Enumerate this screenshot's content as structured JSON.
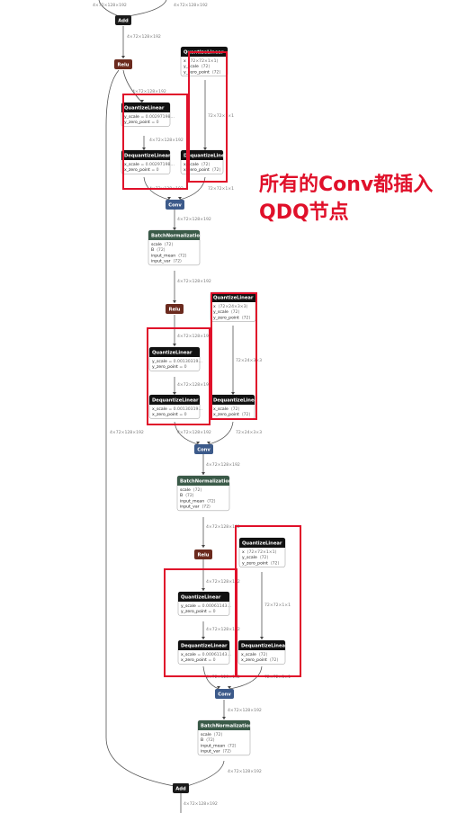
{
  "annotation": {
    "line1": "所有的Conv都插入",
    "line2": "QDQ节点"
  },
  "colors": {
    "add": "#1a1a1a",
    "relu": "#6b2a1e",
    "conv": "#3c5a8a",
    "bn": "#3a5a48",
    "quant": "#111111",
    "highlight": "#e0102a",
    "edge": "#555555"
  },
  "nodes": {
    "add_top": {
      "label": "Add"
    },
    "relu1": {
      "label": "Relu"
    },
    "quant_w1": {
      "title": "QuantizeLinear",
      "rows": [
        [
          "x",
          "⟨72×72×1×1⟩"
        ],
        [
          "y_scale",
          "⟨72⟩"
        ],
        [
          "y_zero_point",
          "⟨72⟩"
        ]
      ]
    },
    "quant_a1": {
      "title": "QuantizeLinear",
      "rows": [
        [
          "y_scale",
          "= 0.00297198…"
        ],
        [
          "y_zero_point",
          "= 0"
        ]
      ]
    },
    "dequant_a1": {
      "title": "DequantizeLinear",
      "rows": [
        [
          "x_scale",
          "= 0.00297198…"
        ],
        [
          "x_zero_point",
          "= 0"
        ]
      ]
    },
    "dequant_w1": {
      "title": "DequantizeLinear",
      "rows": [
        [
          "x_scale",
          "⟨72⟩"
        ],
        [
          "x_zero_point",
          "⟨72⟩"
        ]
      ]
    },
    "conv1": {
      "label": "Conv"
    },
    "bn1": {
      "title": "BatchNormalization",
      "rows": [
        [
          "scale",
          "⟨72⟩"
        ],
        [
          "B",
          "⟨72⟩"
        ],
        [
          "input_mean",
          "⟨72⟩"
        ],
        [
          "input_var",
          "⟨72⟩"
        ]
      ]
    },
    "relu2": {
      "label": "Relu"
    },
    "quant_w2": {
      "title": "QuantizeLinear",
      "rows": [
        [
          "x",
          "⟨72×24×3×3⟩"
        ],
        [
          "y_scale",
          "⟨72⟩"
        ],
        [
          "y_zero_point",
          "⟨72⟩"
        ]
      ]
    },
    "quant_a2": {
      "title": "QuantizeLinear",
      "rows": [
        [
          "y_scale",
          "= 0.00130319…"
        ],
        [
          "y_zero_point",
          "= 0"
        ]
      ]
    },
    "dequant_a2": {
      "title": "DequantizeLinear",
      "rows": [
        [
          "x_scale",
          "= 0.00130319…"
        ],
        [
          "x_zero_point",
          "= 0"
        ]
      ]
    },
    "dequant_w2": {
      "title": "DequantizeLinear",
      "rows": [
        [
          "x_scale",
          "⟨72⟩"
        ],
        [
          "x_zero_point",
          "⟨72⟩"
        ]
      ]
    },
    "conv2": {
      "label": "Conv"
    },
    "bn2": {
      "title": "BatchNormalization",
      "rows": [
        [
          "scale",
          "⟨72⟩"
        ],
        [
          "B",
          "⟨72⟩"
        ],
        [
          "input_mean",
          "⟨72⟩"
        ],
        [
          "input_var",
          "⟨72⟩"
        ]
      ]
    },
    "relu3": {
      "label": "Relu"
    },
    "quant_w3": {
      "title": "QuantizeLinear",
      "rows": [
        [
          "x",
          "⟨72×72×1×1⟩"
        ],
        [
          "y_scale",
          "⟨72⟩"
        ],
        [
          "y_zero_point",
          "⟨72⟩"
        ]
      ]
    },
    "quant_a3": {
      "title": "QuantizeLinear",
      "rows": [
        [
          "y_scale",
          "= 0.00061143…"
        ],
        [
          "y_zero_point",
          "= 0"
        ]
      ]
    },
    "dequant_a3": {
      "title": "DequantizeLinear",
      "rows": [
        [
          "x_scale",
          "= 0.00061143…"
        ],
        [
          "x_zero_point",
          "= 0"
        ]
      ]
    },
    "dequant_w3": {
      "title": "DequantizeLinear",
      "rows": [
        [
          "x_scale",
          "⟨72⟩"
        ],
        [
          "x_zero_point",
          "⟨72⟩"
        ]
      ]
    },
    "conv3": {
      "label": "Conv"
    },
    "bn3": {
      "title": "BatchNormalization",
      "rows": [
        [
          "scale",
          "⟨72⟩"
        ],
        [
          "B",
          "⟨72⟩"
        ],
        [
          "input_mean",
          "⟨72⟩"
        ],
        [
          "input_var",
          "⟨72⟩"
        ]
      ]
    },
    "add_bottom": {
      "label": "Add"
    }
  },
  "edge_labels": {
    "act": "4×72×128×192",
    "w1x1": "72×72×1×1",
    "w3x3": "72×24×3×3"
  }
}
